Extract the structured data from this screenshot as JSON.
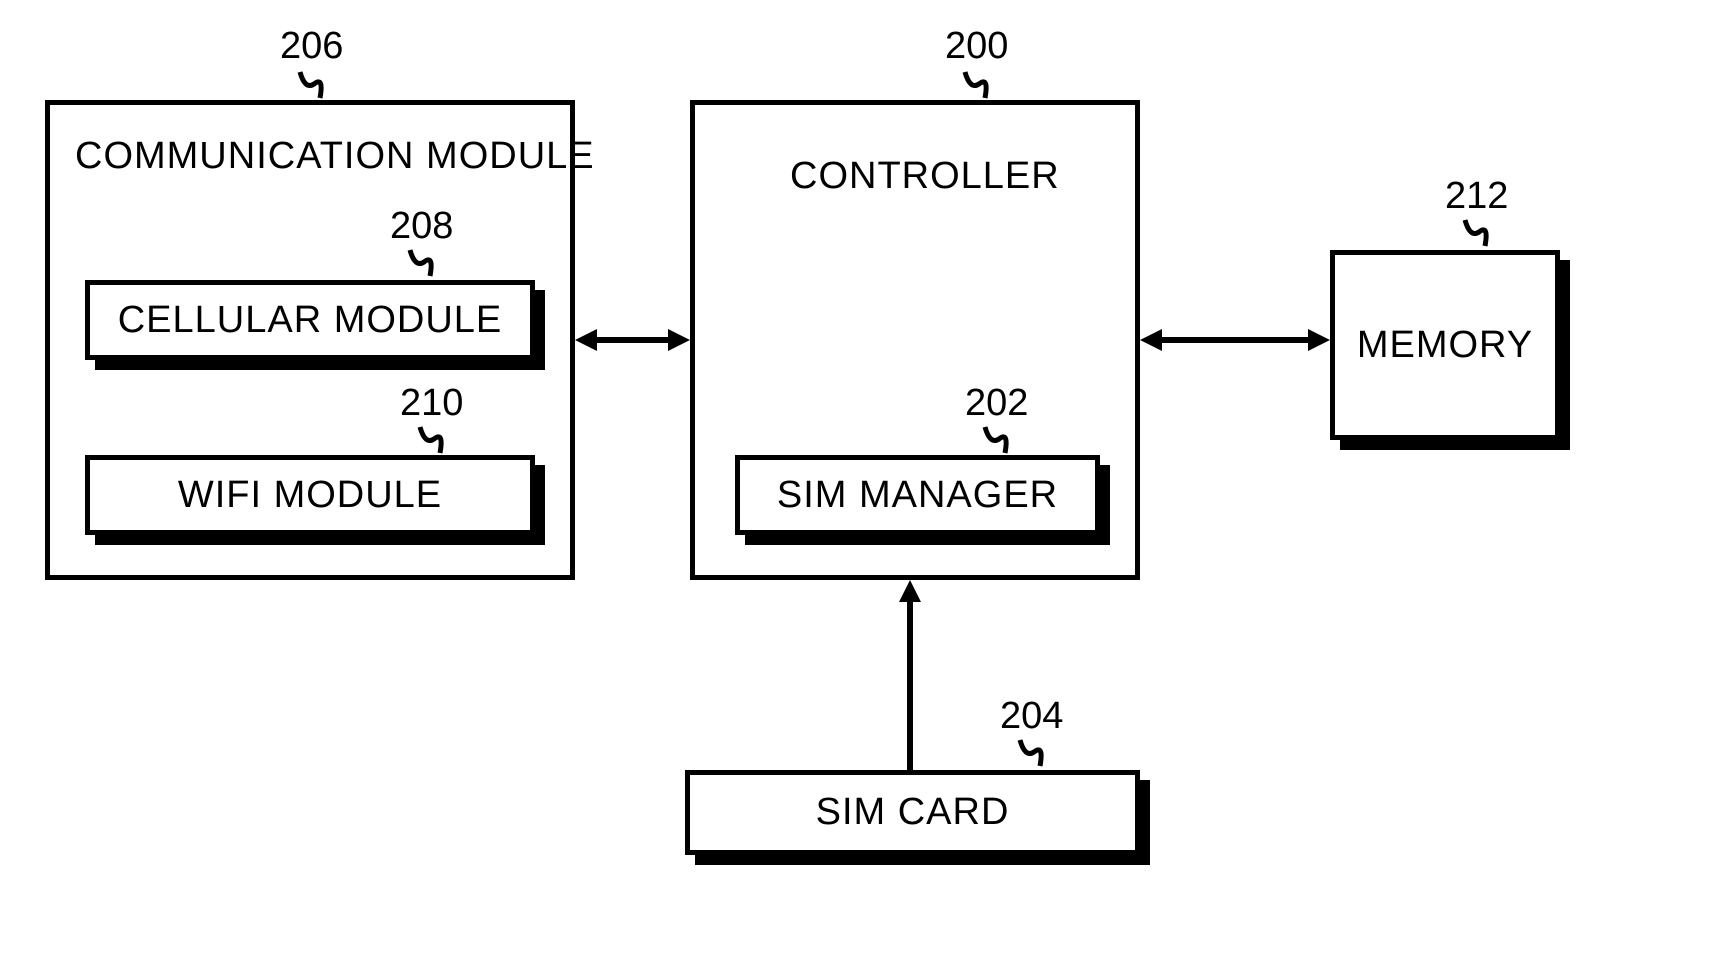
{
  "blocks": {
    "comm_module": {
      "title": "COMMUNICATION MODULE",
      "ref": "206"
    },
    "cellular": {
      "title": "CELLULAR MODULE",
      "ref": "208"
    },
    "wifi": {
      "title": "WIFI MODULE",
      "ref": "210"
    },
    "controller": {
      "title": "CONTROLLER",
      "ref": "200"
    },
    "sim_manager": {
      "title": "SIM MANAGER",
      "ref": "202"
    },
    "sim_card": {
      "title": "SIM CARD",
      "ref": "204"
    },
    "memory": {
      "title": "MEMORY",
      "ref": "212"
    }
  }
}
